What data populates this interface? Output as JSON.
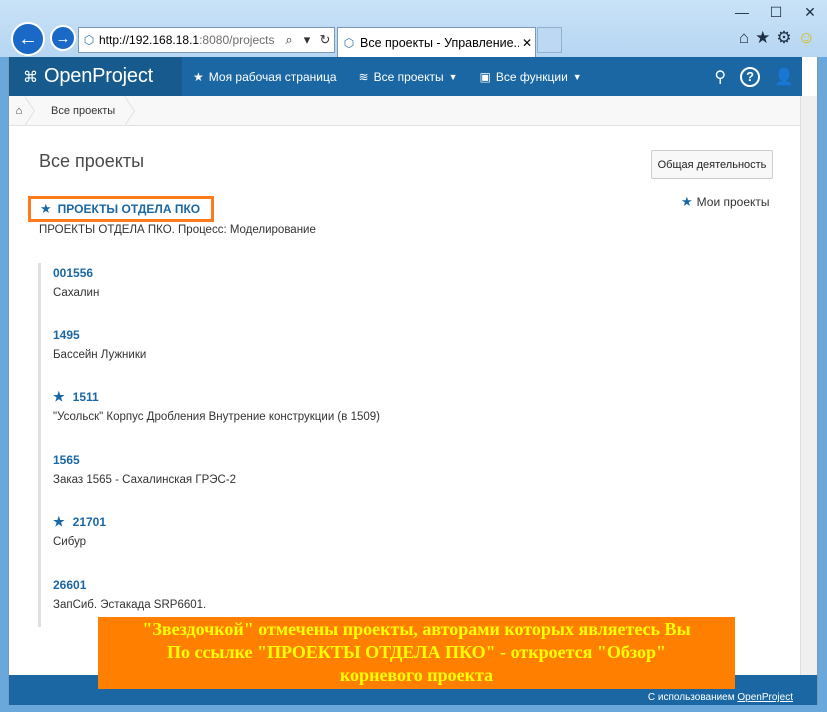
{
  "browser": {
    "url_host": "http://192.168.18.1",
    "url_rest": ":8080/projects",
    "tab_title": "Все проекты - Управление...",
    "controls": {
      "minimize": "—",
      "maximize": "☐",
      "close": "✕"
    }
  },
  "header": {
    "logo": "OpenProject",
    "menu": [
      {
        "label": "Моя рабочая страница",
        "icon": "star-icon"
      },
      {
        "label": "Все проекты",
        "icon": "stack-icon"
      },
      {
        "label": "Все функции",
        "icon": "box-icon"
      }
    ]
  },
  "breadcrumb": {
    "item": "Все проекты"
  },
  "page": {
    "title": "Все проекты",
    "activity_button": "Общая деятельность",
    "my_projects": "Мои проекты"
  },
  "root_project": {
    "name": "ПРОЕКТЫ ОТДЕЛА ПКО",
    "description": "ПРОЕКТЫ ОТДЕЛА ПКО. Процесс: Моделирование",
    "starred": true
  },
  "children": [
    {
      "name": "001556",
      "description": "Сахалин",
      "starred": false
    },
    {
      "name": "1495",
      "description": "Бассейн Лужники",
      "starred": false
    },
    {
      "name": "1511",
      "description": "\"Усольск\" Корпус Дробления Внутрение конструкции (в 1509)",
      "starred": true
    },
    {
      "name": "1565",
      "description": "Заказ 1565 - Сахалинская ГРЭС-2",
      "starred": false
    },
    {
      "name": "21701",
      "description": "Сибур",
      "starred": true
    },
    {
      "name": "26601",
      "description": "ЗапСиб. Эстакада SRP6601.",
      "starred": false
    }
  ],
  "footer": {
    "prefix": "С использованием",
    "link": "OpenProject"
  },
  "annotation": {
    "line1": "\"Звездочкой\" отмечены проекты, авторами которых являетесь Вы",
    "line2": "По ссылке \"ПРОЕКТЫ ОТДЕЛА ПКО\" - откроется \"Обзор\"",
    "line3": "корневого проекта"
  },
  "colors": {
    "accent": "#1a67a3",
    "highlight": "#ff7a1a",
    "annotation_bg": "#ff8000",
    "annotation_text": "#ffff00"
  }
}
